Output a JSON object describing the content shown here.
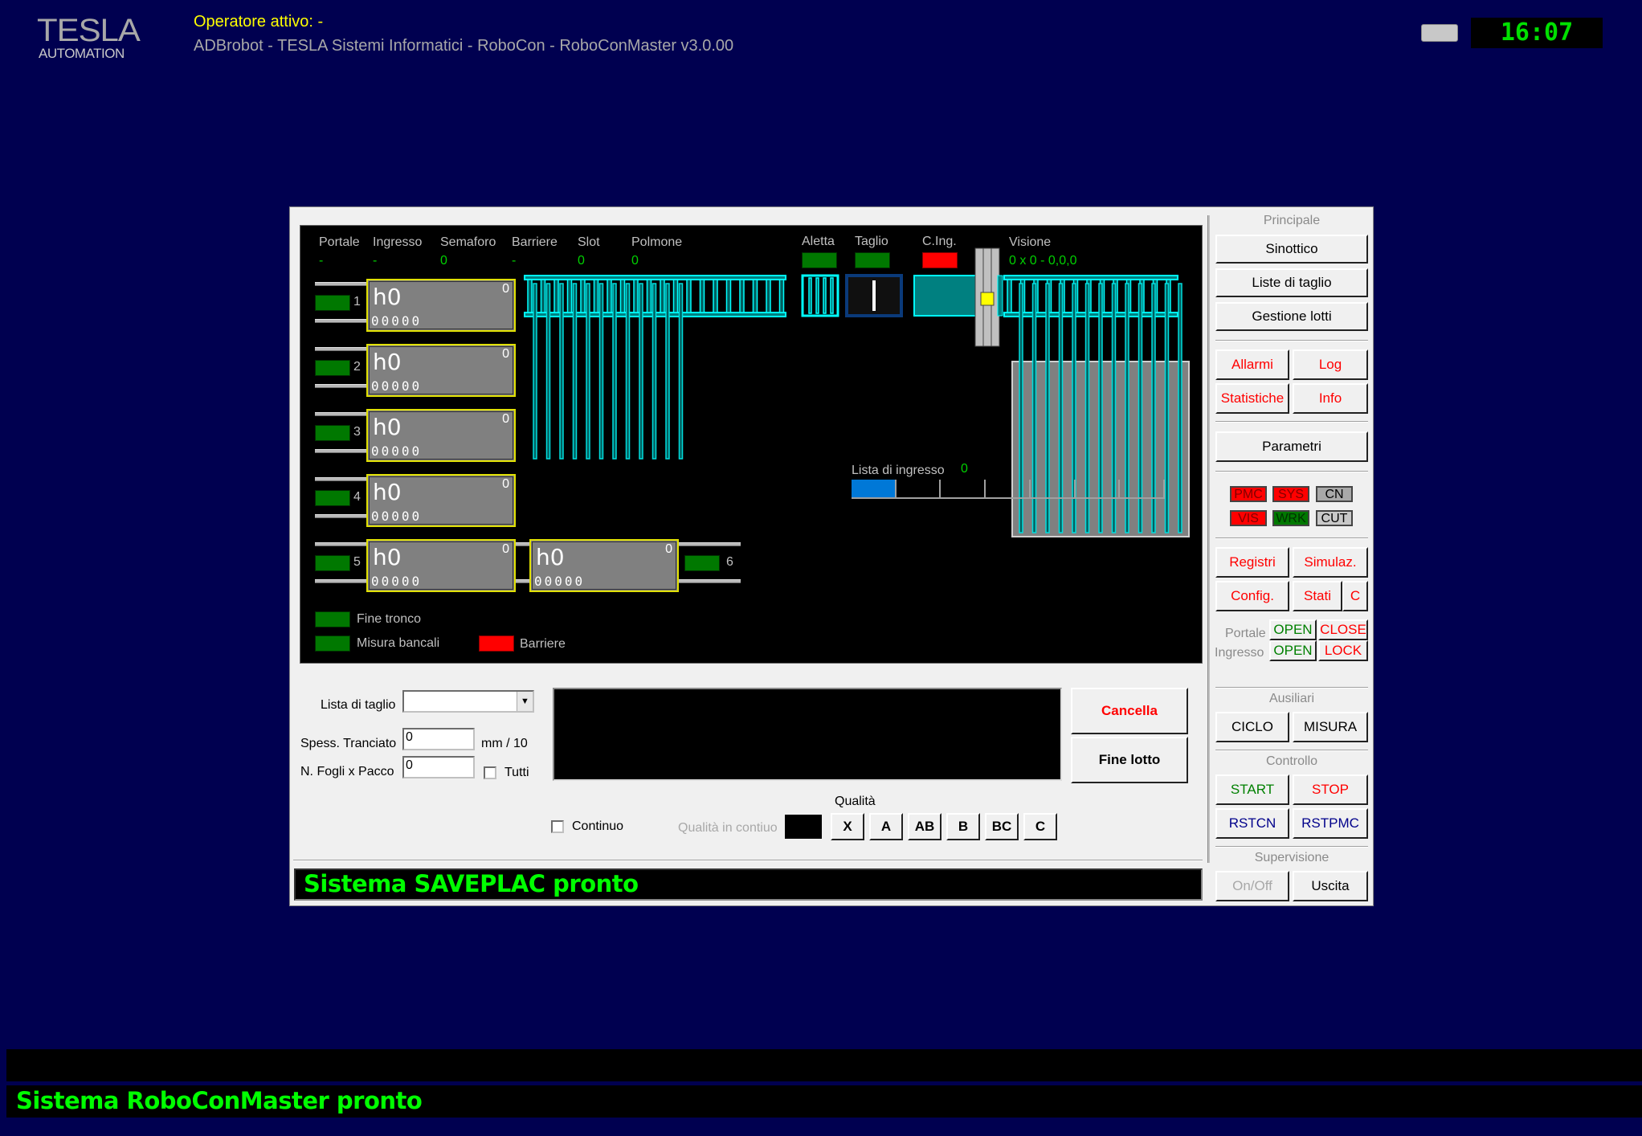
{
  "header": {
    "logo_main": "TESLA",
    "logo_sub": "AUTOMATION",
    "operator": "Operatore attivo: -",
    "app_title": "ADBrobot - TESLA Sistemi Informatici - RoboCon - RoboConMaster v3.0.00",
    "clock": "16:07"
  },
  "sinottico": {
    "status_columns": [
      {
        "label": "Portale",
        "value": "-"
      },
      {
        "label": "Ingresso",
        "value": "-"
      },
      {
        "label": "Semaforo",
        "value": "0"
      },
      {
        "label": "Barriere",
        "value": "-"
      },
      {
        "label": "Slot",
        "value": "0"
      },
      {
        "label": "Polmone",
        "value": "0"
      }
    ],
    "aletta_label": "Aletta",
    "taglio_label": "Taglio",
    "cing_label": "C.Ing.",
    "visione_label": "Visione",
    "visione_value": "0 x 0 - 0,0,0",
    "slots": [
      {
        "number": "1",
        "height": "h0",
        "count": "0",
        "code": "00000"
      },
      {
        "number": "2",
        "height": "h0",
        "count": "0",
        "code": "00000"
      },
      {
        "number": "3",
        "height": "h0",
        "count": "0",
        "code": "00000"
      },
      {
        "number": "4",
        "height": "h0",
        "count": "0",
        "code": "00000"
      },
      {
        "number": "5",
        "height": "h0",
        "count": "0",
        "code": "00000"
      },
      {
        "number": "6",
        "height": "h0",
        "count": "0",
        "code": "00000"
      }
    ],
    "lista_ingresso_label": "Lista di ingresso",
    "lista_ingresso_value": "0",
    "lista_ingresso_filled_segments": 1,
    "lista_ingresso_total_segments": 7,
    "legend": [
      {
        "label": "Fine tronco",
        "color": "#007800"
      },
      {
        "label": "Misura bancali",
        "color": "#007800"
      },
      {
        "label": "Barriere",
        "color": "#ff0000"
      }
    ]
  },
  "form": {
    "lista_taglio_label": "Lista di taglio",
    "lista_taglio_value": "",
    "spess_label": "Spess. Tranciato",
    "spess_value": "0",
    "spess_unit": "mm / 10",
    "fogli_label": "N. Fogli x Pacco",
    "fogli_value": "0",
    "tutti_label": "Tutti",
    "continuo_label": "Continuo",
    "qualita_title": "Qualità",
    "qualita_continuo_label": "Qualità in contiuo",
    "quality_buttons": [
      "X",
      "A",
      "AB",
      "B",
      "BC",
      "C"
    ],
    "cancella_label": "Cancella",
    "fine_lotto_label": "Fine lotto"
  },
  "status": {
    "window_message": "Sistema SAVEPLAC pronto",
    "main_message": "Sistema RoboConMaster pronto"
  },
  "right_panel": {
    "principale_title": "Principale",
    "sinottico": "Sinottico",
    "liste_taglio": "Liste di taglio",
    "gestione_lotti": "Gestione lotti",
    "allarmi": "Allarmi",
    "log": "Log",
    "statistiche": "Statistiche",
    "info": "Info",
    "parametri": "Parametri",
    "indicators": [
      {
        "label": "PMC",
        "state": "red"
      },
      {
        "label": "SYS",
        "state": "red"
      },
      {
        "label": "CN",
        "state": "grey"
      },
      {
        "label": "VIS",
        "state": "red"
      },
      {
        "label": "WRK",
        "state": "green"
      },
      {
        "label": "CUT",
        "state": "lightgrey"
      }
    ],
    "registri": "Registri",
    "simulaz": "Simulaz.",
    "config": "Config.",
    "stati": "Stati",
    "c": "C",
    "portale_label": "Portale",
    "ingresso_label": "Ingresso",
    "open": "OPEN",
    "close": "CLOSE",
    "lock": "LOCK",
    "ausiliari_title": "Ausiliari",
    "ciclo": "CICLO",
    "misura": "MISURA",
    "controllo_title": "Controllo",
    "start": "START",
    "stop": "STOP",
    "rstcn": "RSTCN",
    "rstpmc": "RSTPMC",
    "supervisione_title": "Supervisione",
    "onoff": "On/Off",
    "uscita": "Uscita"
  }
}
